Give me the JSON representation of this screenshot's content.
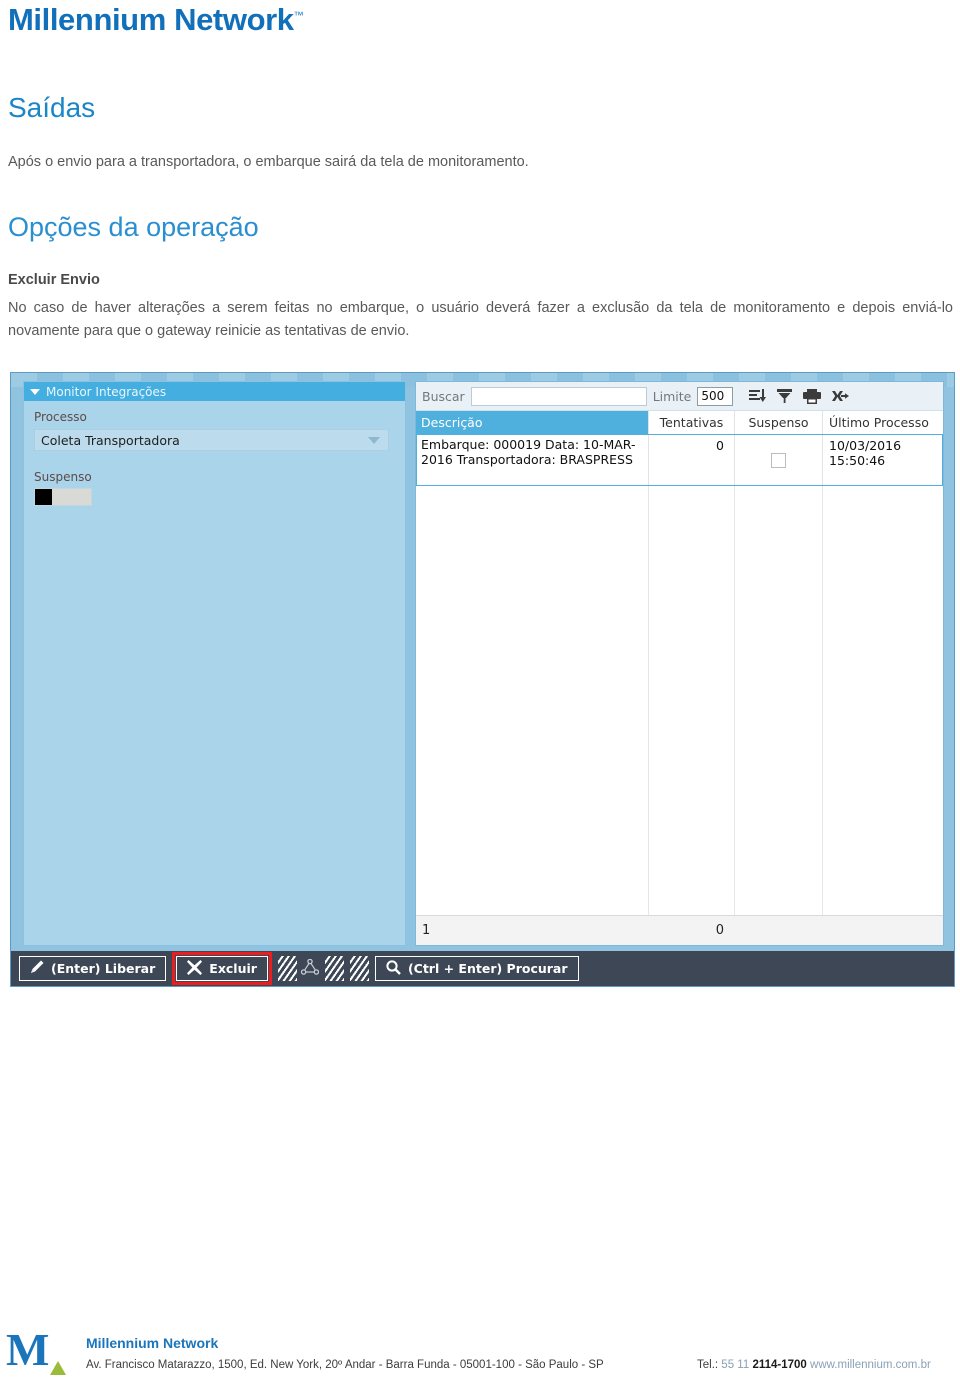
{
  "document": {
    "brand_title": "Millennium Network",
    "brand_tm": "™",
    "heading_1": "Saídas",
    "lead_paragraph": "Após o envio para a transportadora, o embarque sairá da tela de monitoramento.",
    "heading_2": "Opções da operação",
    "subheading": "Excluir Envio",
    "body_paragraph": "No caso de haver alterações a serem feitas no embarque, o usuário deverá fazer a exclusão da tela de monitoramento e depois enviá-lo novamente para que o gateway reinicie as tentativas de envio."
  },
  "app": {
    "left_panel": {
      "title": "Monitor Integrações",
      "caret_icon": "caret-down-icon",
      "processo_label": "Processo",
      "processo_value": "Coleta Transportadora",
      "suspenso_label": "Suspenso",
      "suspenso_state": "off"
    },
    "search_bar": {
      "buscar_label": "Buscar",
      "buscar_value": "",
      "buscar_placeholder": "",
      "limite_label": "Limite",
      "limite_value": "500",
      "icons": [
        "sort-descending-icon",
        "filter-funnel-icon",
        "printer-icon",
        "export-excel-icon"
      ]
    },
    "grid": {
      "columns": [
        "Descrição",
        "Tentativas",
        "Suspenso",
        "Último Processo"
      ],
      "rows": [
        {
          "descricao": "Embarque: 000019 Data: 10-MAR-2016 Transportadora: BRASPRESS",
          "tentativas": "0",
          "suspenso_checked": false,
          "ultimo_processo": "10/03/2016 15:50:46"
        }
      ],
      "footer": {
        "row_count": "1",
        "tentativas_total": "0"
      }
    },
    "toolbar": {
      "liberar_label": "(Enter) Liberar",
      "liberar_icon": "pencil-icon",
      "excluir_label": "Excluir",
      "excluir_icon": "x-cross-icon",
      "excluir_highlight_color": "#ee1c1c",
      "graph_icon": "node-graph-icon",
      "procurar_label": "(Ctrl + Enter) Procurar",
      "procurar_icon": "magnifier-icon"
    }
  },
  "footer": {
    "logo_letter": "M",
    "brand": "Millennium Network",
    "address": "Av. Francisco Matarazzo, 1500, Ed. New York, 20º Andar  - Barra Funda - 05001-100 - São Paulo - SP",
    "tel_label": "Tel.:",
    "tel_prefix": "55 11",
    "tel_number": "2114-1700",
    "website": "www.millennium.com.br"
  }
}
